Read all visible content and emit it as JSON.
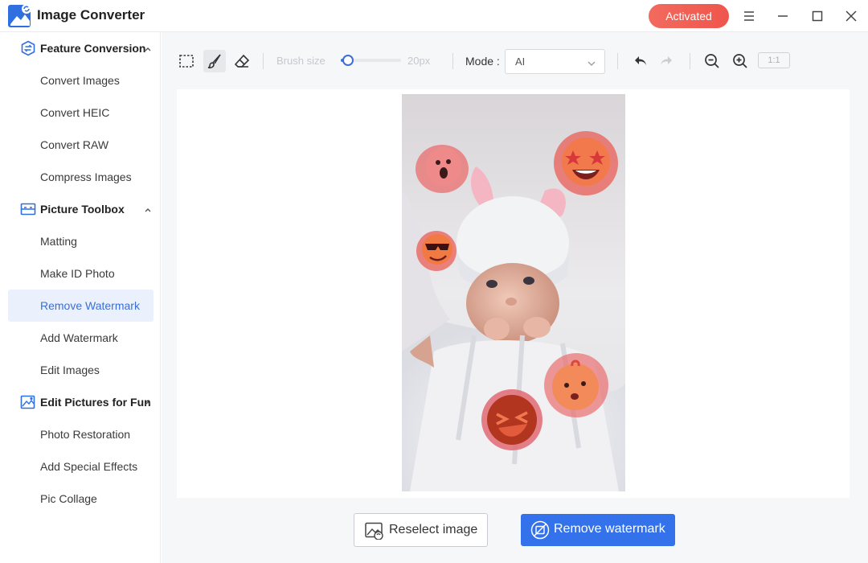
{
  "app": {
    "title": "Image Converter",
    "activated_label": "Activated",
    "accent_color": "#3372ea",
    "activated_color": "#f0554c"
  },
  "window_controls": {
    "menu_icon": "hamburger-icon",
    "minimize_icon": "minimize-icon",
    "maximize_icon": "maximize-icon",
    "close_icon": "close-icon"
  },
  "sidebar": {
    "groups": [
      {
        "label": "Feature Conversion",
        "icon": "exchange-circle-icon",
        "expanded": true,
        "items": [
          "Convert Images",
          "Convert HEIC",
          "Convert RAW",
          "Compress Images"
        ]
      },
      {
        "label": "Picture Toolbox",
        "icon": "toolbox-icon",
        "expanded": true,
        "items": [
          "Matting",
          "Make ID Photo",
          "Remove Watermark",
          "Add Watermark",
          "Edit Images"
        ]
      },
      {
        "label": "Edit Pictures for Fun",
        "icon": "picture-edit-icon",
        "expanded": true,
        "items": [
          "Photo Restoration",
          "Add Special Effects",
          "Pic Collage"
        ]
      }
    ],
    "active_item": "Remove Watermark"
  },
  "toolbar": {
    "tools": [
      "rectangle-select-icon",
      "brush-icon",
      "eraser-icon"
    ],
    "selected_tool": "brush-icon",
    "brush_size_label": "Brush size",
    "brush_size_value": "20px",
    "brush_size_fraction": 0.12,
    "mode_label": "Mode :",
    "mode_value": "AI",
    "undo_icon": "undo-icon",
    "redo_icon": "redo-icon",
    "zoom_out_icon": "zoom-out-icon",
    "zoom_in_icon": "zoom-in-icon",
    "zoom_reset_label": "1:1"
  },
  "canvas": {
    "image_description_icon": "baby-photo-with-emoji-stickers"
  },
  "actions": {
    "reselect_label": "Reselect image",
    "remove_label": "Remove watermark"
  }
}
